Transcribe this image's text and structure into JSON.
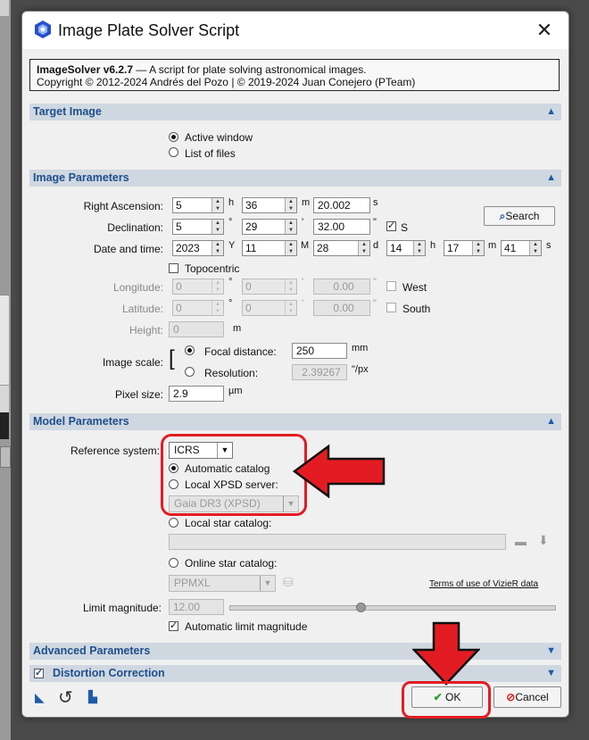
{
  "dialog": {
    "title": "Image Plate Solver Script",
    "close_glyph": "✕",
    "info_name": "ImageSolver v6.2.7",
    "info_desc": " — A script for plate solving astronomical images.",
    "info_copyright": "Copyright © 2012-2024 Andrés del Pozo | © 2019-2024 Juan Conejero (PTeam)"
  },
  "sections": {
    "target_image": "Target Image",
    "image_parameters": "Image Parameters",
    "model_parameters": "Model Parameters",
    "advanced_parameters": "Advanced Parameters",
    "distortion_correction": "Distortion Correction"
  },
  "target": {
    "active_window": "Active window",
    "list_of_files": "List of files",
    "selected": "active_window"
  },
  "image_params": {
    "ra_label": "Right Ascension:",
    "ra_h": "5",
    "ra_h_unit": "h",
    "ra_m": "36",
    "ra_m_unit": "m",
    "ra_s": "20.002",
    "ra_s_unit": "s",
    "dec_label": "Declination:",
    "dec_d": "5",
    "dec_d_unit": "°",
    "dec_m": "29",
    "dec_m_unit": "'",
    "dec_s": "32.00",
    "dec_s_unit": "\"",
    "dec_south_label": "S",
    "search_label": "Search",
    "date_label": "Date and time:",
    "year": "2023",
    "year_unit": "Y",
    "month": "11",
    "month_unit": "M",
    "day": "28",
    "day_unit": "d",
    "hour": "14",
    "hour_unit": "h",
    "minute": "17",
    "minute_unit": "m",
    "second": "41",
    "second_unit": "s",
    "topocentric": "Topocentric",
    "lon_label": "Longitude:",
    "lon_d": "0",
    "lon_m": "0",
    "lon_s": "0.00",
    "west_label": "West",
    "lat_label": "Latitude:",
    "lat_d": "0",
    "lat_m": "0",
    "lat_s": "0.00",
    "south_label": "South",
    "height_label": "Height:",
    "height": "0",
    "height_unit": "m",
    "scale_label": "Image scale:",
    "focal_label": "Focal distance:",
    "focal": "250",
    "focal_unit": "mm",
    "resolution_label": "Resolution:",
    "resolution": "2.39267",
    "resolution_unit": "\"/px",
    "pixel_label": "Pixel size:",
    "pixel": "2.9",
    "pixel_unit": "µm"
  },
  "model_params": {
    "refsys_label": "Reference system:",
    "refsys": "ICRS",
    "automatic_catalog": "Automatic catalog",
    "local_xpsd": "Local XPSD server:",
    "xpsd_value": "Gaia DR3 (XPSD)",
    "local_star": "Local star catalog:",
    "online_star": "Online star catalog:",
    "online_value": "PPMXL",
    "terms_link": "Terms of use of VizieR data",
    "limit_label": "Limit magnitude:",
    "limit_value": "12.00",
    "limit_fraction": 0.4,
    "auto_limit": "Automatic limit magnitude"
  },
  "footer": {
    "ok_label": "OK",
    "cancel_label": "Cancel"
  },
  "colors": {
    "section_bg": "#cfd8e1",
    "section_text": "#1f4f8a",
    "annotation_red": "#e31c24"
  }
}
